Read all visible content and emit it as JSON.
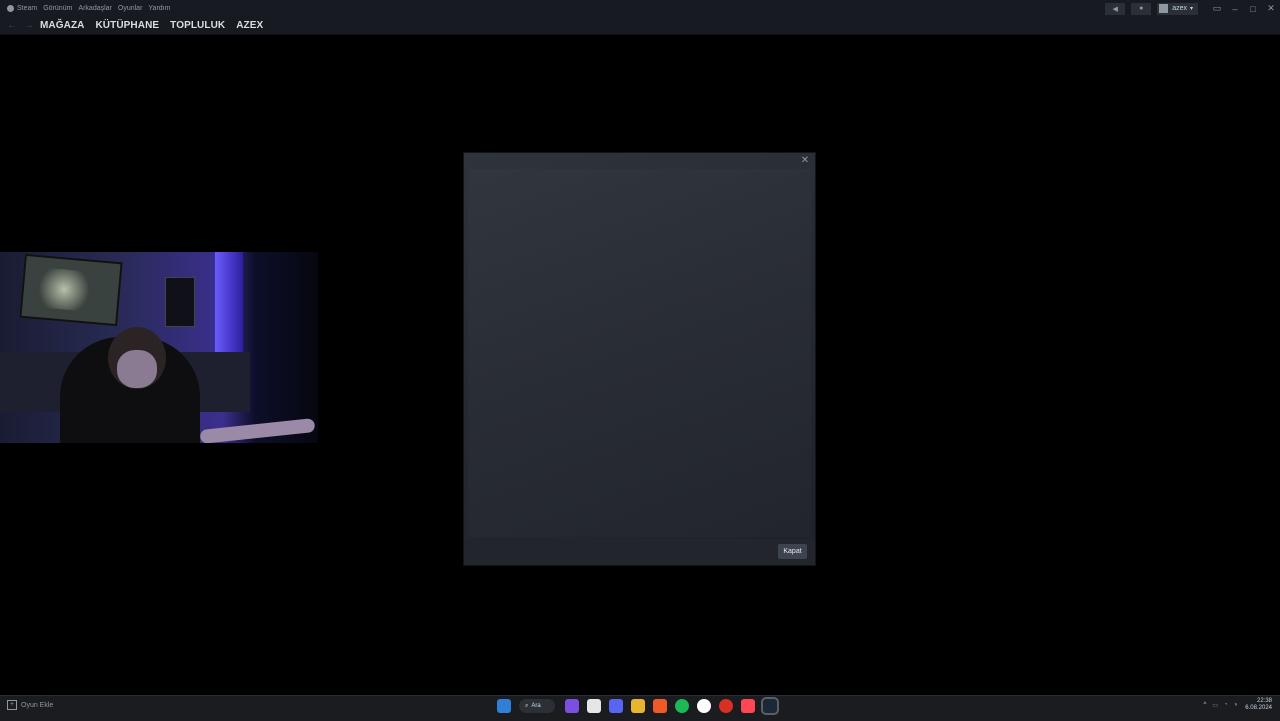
{
  "menubar": {
    "items": [
      "Steam",
      "Görünüm",
      "Arkadaşlar",
      "Oyunlar",
      "Yardım"
    ],
    "username": "azex",
    "window_controls": [
      "minimize-icon",
      "maximize-icon",
      "close-icon"
    ]
  },
  "navbar": {
    "back_icon": "arrow-left-icon",
    "forward_icon": "arrow-right-icon",
    "tabs": [
      "MAĞAZA",
      "KÜTÜPHANE",
      "TOPLULUK",
      "AZEX"
    ]
  },
  "modal": {
    "close_icon": "close-icon",
    "close_button": "Kapat"
  },
  "bottom": {
    "add_game": "Oyun Ekle"
  },
  "taskbar": {
    "search_label": "Ara",
    "apps": [
      "windows-start-icon",
      "search-icon",
      "twitch-icon",
      "obs-icon",
      "discord-icon",
      "file-explorer-icon",
      "brave-icon",
      "spotify-icon",
      "obs-studio-icon",
      "chrome-icon",
      "valorant-icon",
      "steam-icon"
    ]
  },
  "tray": {
    "time": "22:38",
    "date": "6.08.2024"
  },
  "colors": {
    "steam_header": "#171a21",
    "modal_bg": "#2f343c",
    "button_bg": "#3d4450",
    "webcam_light": "#6a5cff"
  }
}
